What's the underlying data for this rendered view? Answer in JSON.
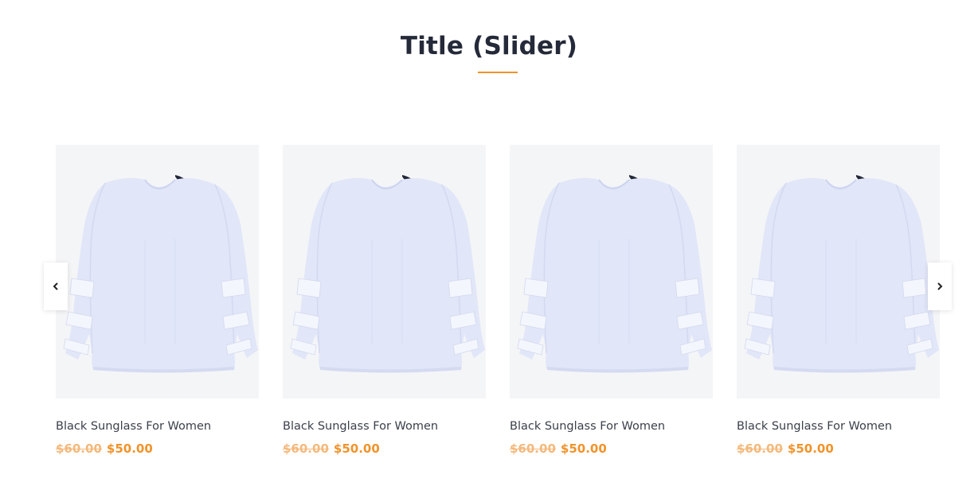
{
  "section": {
    "title": "Title (Slider)",
    "accent_color": "#f0932b"
  },
  "slider": {
    "prev_icon": "chevron-left-icon",
    "next_icon": "chevron-right-icon",
    "products": [
      {
        "name": "Black Sunglass For Women",
        "old_price": "$60.00",
        "new_price": "$50.00",
        "image": "blouse-image"
      },
      {
        "name": "Black Sunglass For Women",
        "old_price": "$60.00",
        "new_price": "$50.00",
        "image": "blouse-image"
      },
      {
        "name": "Black Sunglass For Women",
        "old_price": "$60.00",
        "new_price": "$50.00",
        "image": "blouse-image"
      },
      {
        "name": "Black Sunglass For Women",
        "old_price": "$60.00",
        "new_price": "$50.00",
        "image": "blouse-image"
      }
    ]
  }
}
